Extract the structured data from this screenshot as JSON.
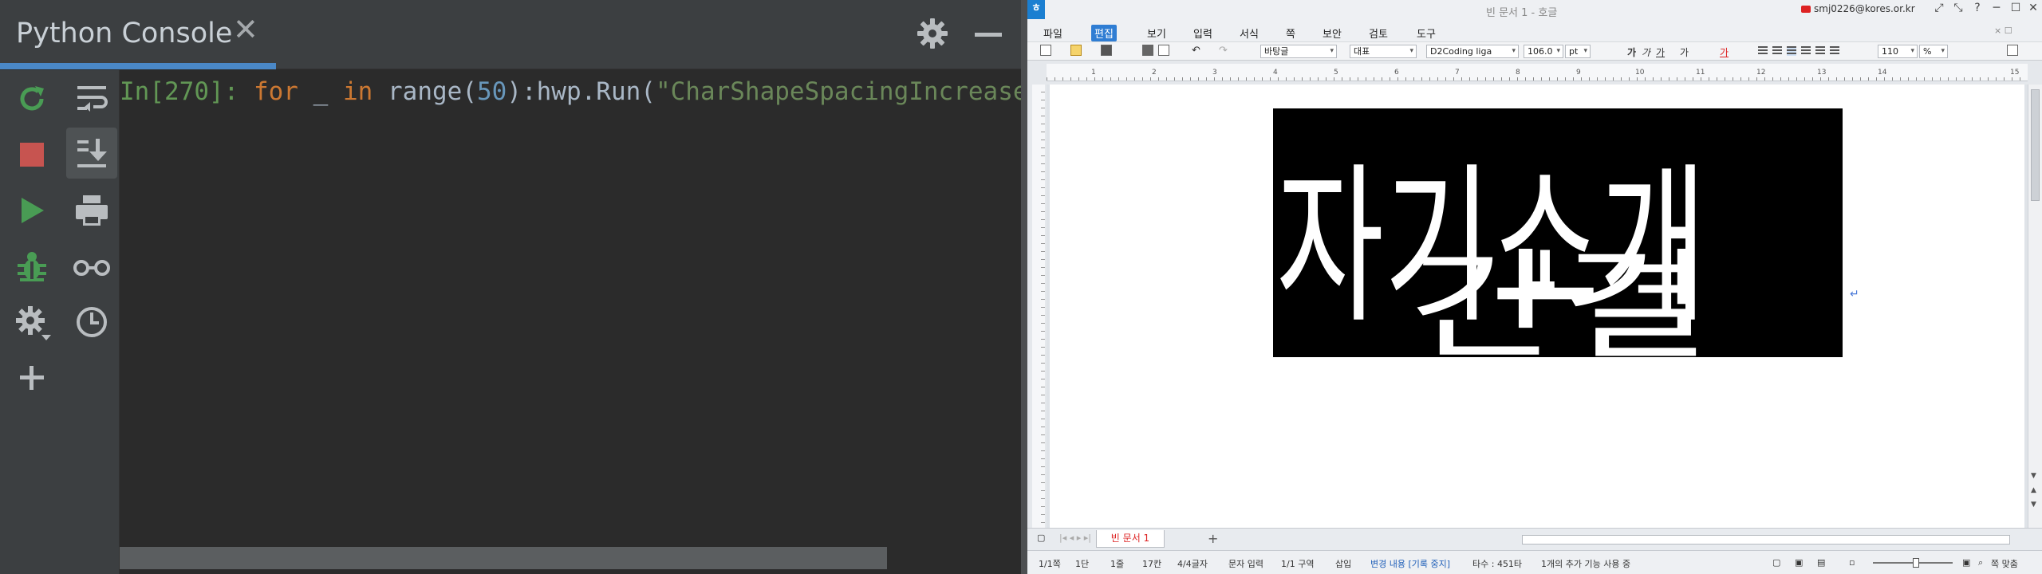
{
  "python_console": {
    "title": "Python Console",
    "close_glyph": "✕",
    "prompt": "In[270]:",
    "code_tokens": {
      "kw_for": "for",
      "var": "_",
      "kw_in": "in",
      "func": "range(",
      "num": "50",
      "mid": "):hwp.Run(",
      "str": "\"CharShapeSpacingIncrease\"",
      "end": ")"
    },
    "left_toolbar": [
      "rerun-icon",
      "stop-icon",
      "run-icon",
      "debug-icon",
      "settings-icon",
      "add-icon"
    ],
    "right_toolbar": [
      "soft-wrap-icon",
      "scroll-to-end-icon",
      "print-icon",
      "glasses-icon",
      "history-icon"
    ],
    "colors": {
      "run": "#499c54",
      "stop": "#c75450",
      "accent": "#4a88c7"
    }
  },
  "hwp": {
    "window_title": "빈 문서 1 - 호글",
    "account": "smj0226@kores.or.kr",
    "window_controls": [
      "⤢",
      "⤡",
      "?",
      "─",
      "☐",
      "✕"
    ],
    "menus": [
      "파일",
      "편집",
      "보기",
      "입력",
      "서식",
      "쪽",
      "보안",
      "검토",
      "도구"
    ],
    "active_menu": "편집",
    "menu_right": "× ☐",
    "toolbar": {
      "style": "바탕글",
      "font_lang": "대표",
      "font_name": "D2Coding liga",
      "font_size": "106.0",
      "font_unit": "pt",
      "format_buttons": [
        "가",
        "가",
        "가",
        "가",
        "가"
      ],
      "zoom": "110",
      "zoom_unit": "%"
    },
    "ruler_numbers": [
      "1",
      "2",
      "3",
      "4",
      "5",
      "6",
      "7",
      "8",
      "9",
      "10",
      "11",
      "12",
      "13",
      "14",
      "15"
    ],
    "document": {
      "text_lines": [
        "자기소개",
        "간결"
      ],
      "para_mark": "↵"
    },
    "doc_tab": "빈 문서 1",
    "add_tab": "+",
    "status": {
      "page": "1/1쪽",
      "column": "1단",
      "line": "1줄",
      "col": "17칸",
      "chars": "4/4글자",
      "input_mode": "문자 입력",
      "section": "1/1 구역",
      "insert": "삽입",
      "change": "변경 내용 [기록 중지]",
      "typing": "타수 : 451타",
      "extra": "1개의 추가 기능 사용 중",
      "fit": "쪽 맞춤"
    }
  }
}
